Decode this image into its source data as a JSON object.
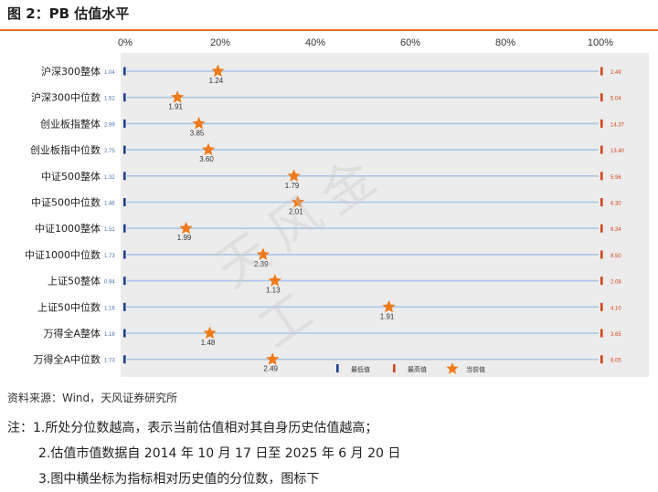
{
  "figure_title": "图 2：PB 估值水平",
  "source": "资料来源：Wind，天风证券研究所",
  "notes": [
    "注：1.所处分位数越高，表示当前估值相对其自身历史估值越高；",
    "2.估值市值数据自 2014 年 10 月 17 日至 2025 年 6 月 20 日",
    "3.图中横坐标为指标相对历史值的分位数，图标下"
  ],
  "watermark": "天风金工",
  "colors": {
    "accent": "#e8721c",
    "min_marker": "#1f3f8f",
    "max_marker": "#d3461c",
    "current_marker": "#f07a1a",
    "range_line": "#a8c8e8",
    "plot_bg": "#ececec"
  },
  "chart_data": {
    "type": "scatter",
    "x_ticks": [
      "0%",
      "20%",
      "40%",
      "60%",
      "80%",
      "100%"
    ],
    "xlim": [
      0,
      100
    ],
    "legend": {
      "placement": "bottom-right",
      "items": [
        "最低值",
        "最高值",
        "当前值"
      ]
    },
    "categories": [
      "沪深300整体",
      "沪深300中位数",
      "创业板指整体",
      "创业板指中位数",
      "中证500整体",
      "中证500中位数",
      "中证1000整体",
      "中证1000中位数",
      "上证50整体",
      "上证50中位数",
      "万得全A整体",
      "万得全A中位数"
    ],
    "min_values": [
      "1.04",
      "1.52",
      "2.99",
      "2.75",
      "1.32",
      "1.46",
      "1.51",
      "1.73",
      "0.94",
      "1.16",
      "1.18",
      "1.73"
    ],
    "max_values": [
      "2.49",
      "5.04",
      "14.37",
      "13.40",
      "5.96",
      "6.30",
      "8.34",
      "8.50",
      "2.08",
      "4.10",
      "3.65",
      "8.05"
    ],
    "current_values": [
      "1.24",
      "1.91",
      "3.85",
      "3.60",
      "1.79",
      "2.01",
      "1.99",
      "2.39",
      "1.13",
      "1.91",
      "1.48",
      "2.49"
    ],
    "percentiles": [
      19.5,
      11,
      15.5,
      17.5,
      35.5,
      36.3,
      12.8,
      29,
      31.5,
      55.5,
      17.8,
      31
    ]
  }
}
